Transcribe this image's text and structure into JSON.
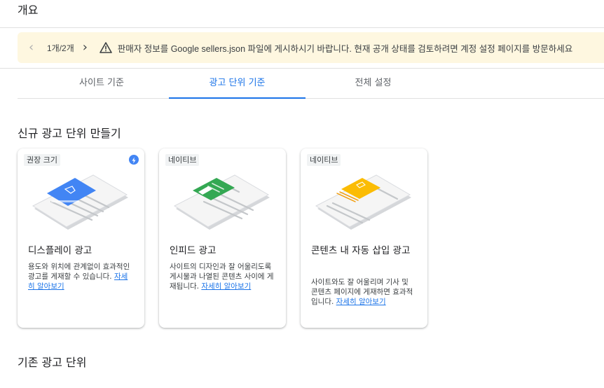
{
  "page": {
    "title": "개요"
  },
  "banner": {
    "pager": "1개/2개",
    "message": "판매자 정보를 Google sellers.json 파일에 게시하시기 바랍니다. 현재 공개 상태를 검토하려면 계정 설정 페이지를 방문하세요",
    "background": "#fef7e0"
  },
  "tabs": [
    {
      "label": "사이트 기준"
    },
    {
      "label": "광고 단위 기준",
      "selected": true
    },
    {
      "label": "전체 설정"
    }
  ],
  "new_section": {
    "title": "신규 광고 단위 만들기"
  },
  "cards": [
    {
      "chip": "권장 크기",
      "title": "디스플레이 광고",
      "desc": "용도와 위치에 관계없이 효과적인 광고를 게재할 수 있습니다.",
      "link": "자세히 알아보기",
      "icon": "display-ad-illustration",
      "accent": "#4285f4"
    },
    {
      "chip": "네이티브",
      "title": "인피드 광고",
      "desc": "사이트의 디자인과 잘 어울리도록 게시물과 나열된 콘텐츠 사이에 게재됩니다.",
      "link": "자세히 알아보기",
      "icon": "infeed-ad-illustration",
      "accent": "#34a853"
    },
    {
      "chip": "네이티브",
      "title": "콘텐츠 내 자동 삽입 광고",
      "desc": "사이트와도 잘 어울리며 기사 및 콘텐츠 페이지에 게재하면 효과적입니다.",
      "link": "자세히 알아보기",
      "icon": "in-article-ad-illustration",
      "accent": "#fbbc04"
    }
  ],
  "existing_section": {
    "title": "기존 광고 단위"
  },
  "colors": {
    "accent": "#1a73e8",
    "warning_bg": "#fef7e0"
  }
}
